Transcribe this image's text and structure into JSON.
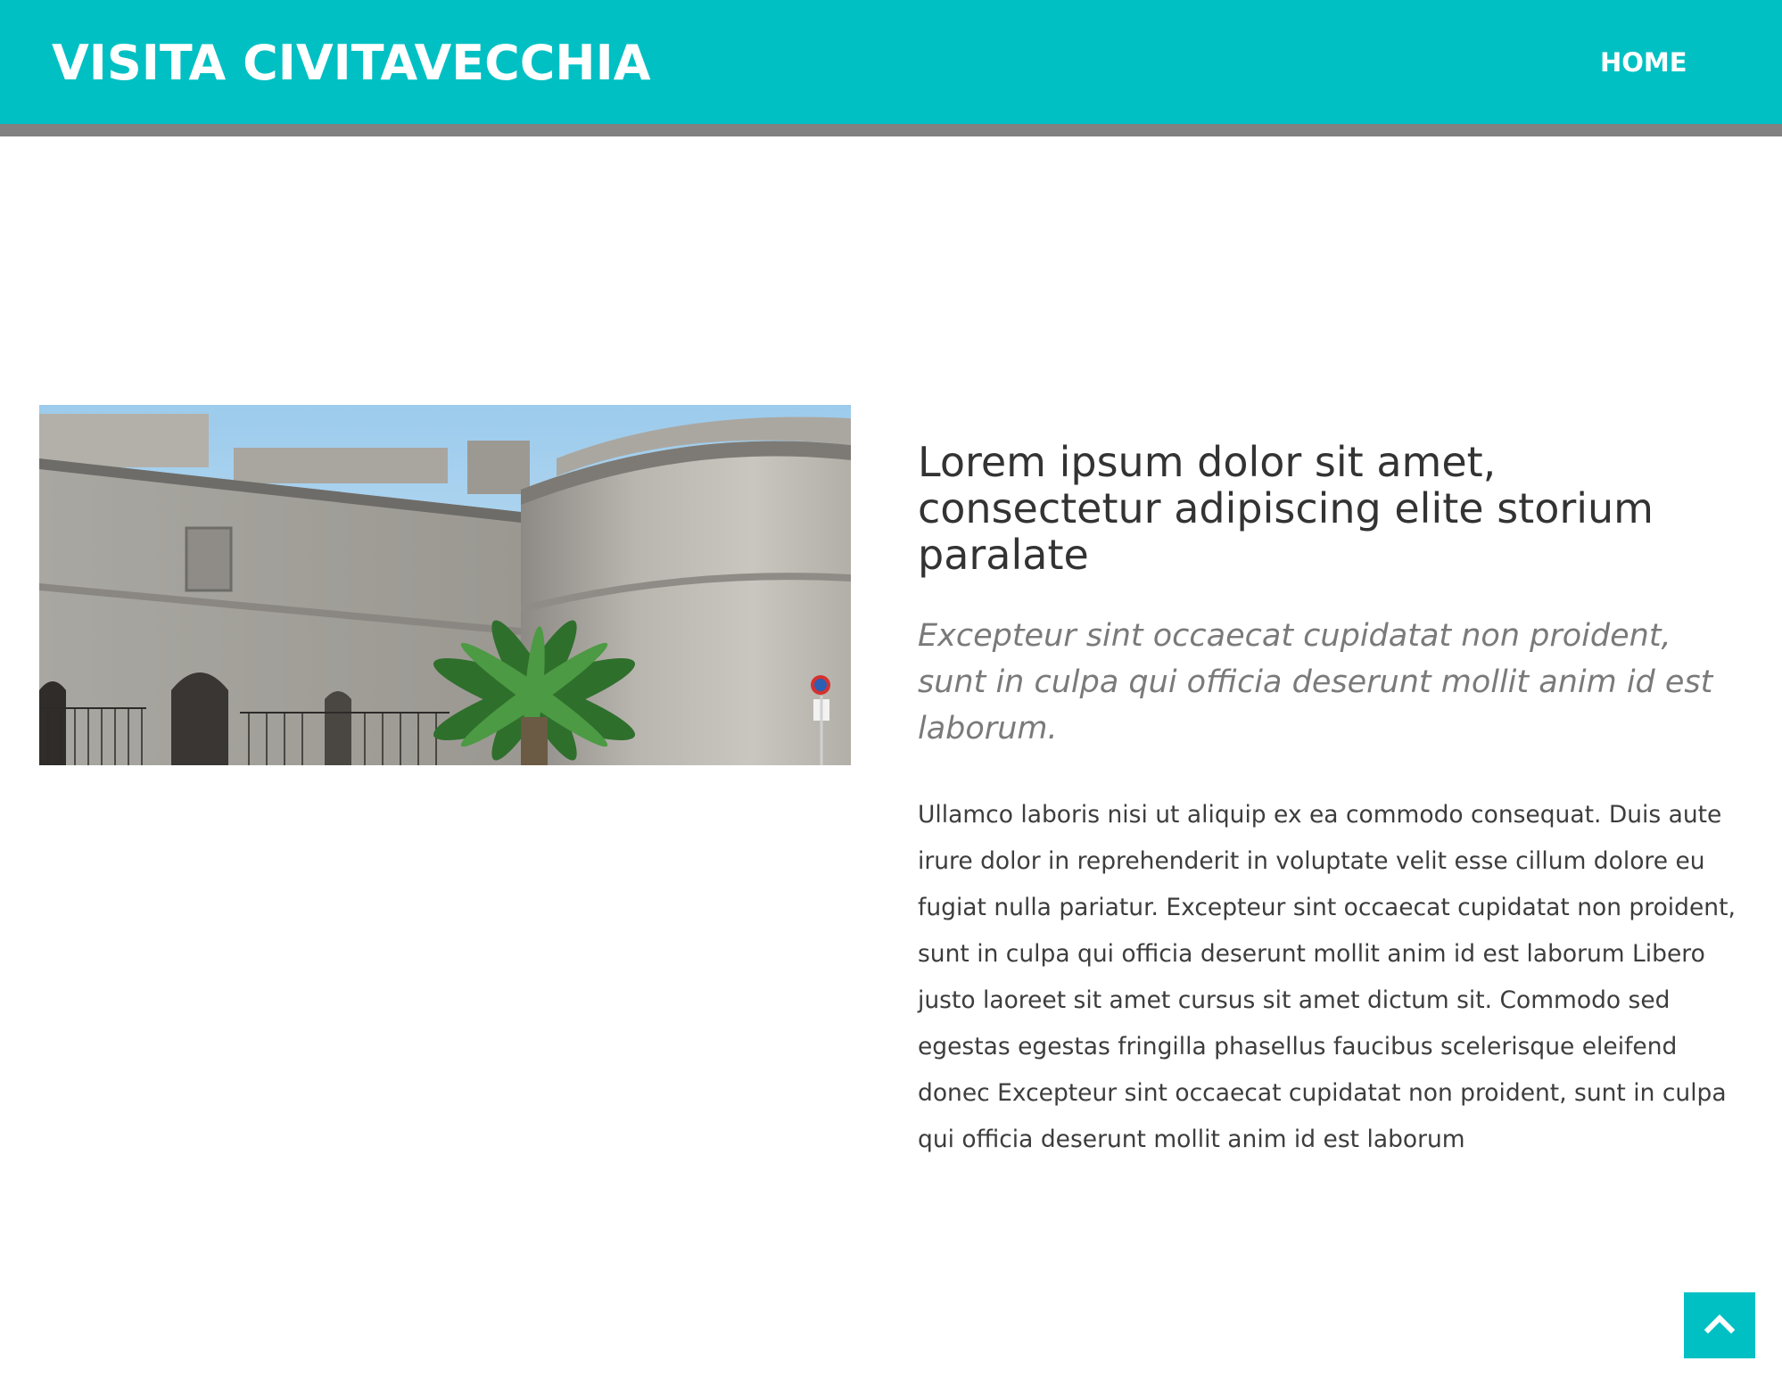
{
  "header": {
    "brand": "VISITA CIVITAVECCHIA",
    "nav": [
      {
        "label": "HOME"
      }
    ],
    "accent_color": "#00c0c3",
    "border_color": "#818181"
  },
  "feature": {
    "image_subject": "stone fortress with palm tree",
    "headline": "Lorem ipsum dolor sit amet, consectetur adipiscing elite storium paralate",
    "lead": "Excepteur sint occaecat cupidatat non proident, sunt in culpa qui officia deserunt mollit anim id est laborum.",
    "body": "Ullamco laboris nisi ut aliquip ex ea commodo consequat. Duis aute irure dolor in reprehenderit in voluptate velit esse cillum dolore eu fugiat nulla pariatur. Excepteur sint occaecat cupidatat non proident, sunt in culpa qui officia deserunt mollit anim id est laborum Libero justo laoreet sit amet cursus sit amet dictum sit. Commodo sed egestas egestas fringilla phasellus faucibus scelerisque eleifend donec Excepteur sint occaecat cupidatat non proident, sunt in culpa qui officia deserunt mollit anim id est laborum"
  },
  "scroll_top": {
    "icon": "chevron-up-icon"
  }
}
